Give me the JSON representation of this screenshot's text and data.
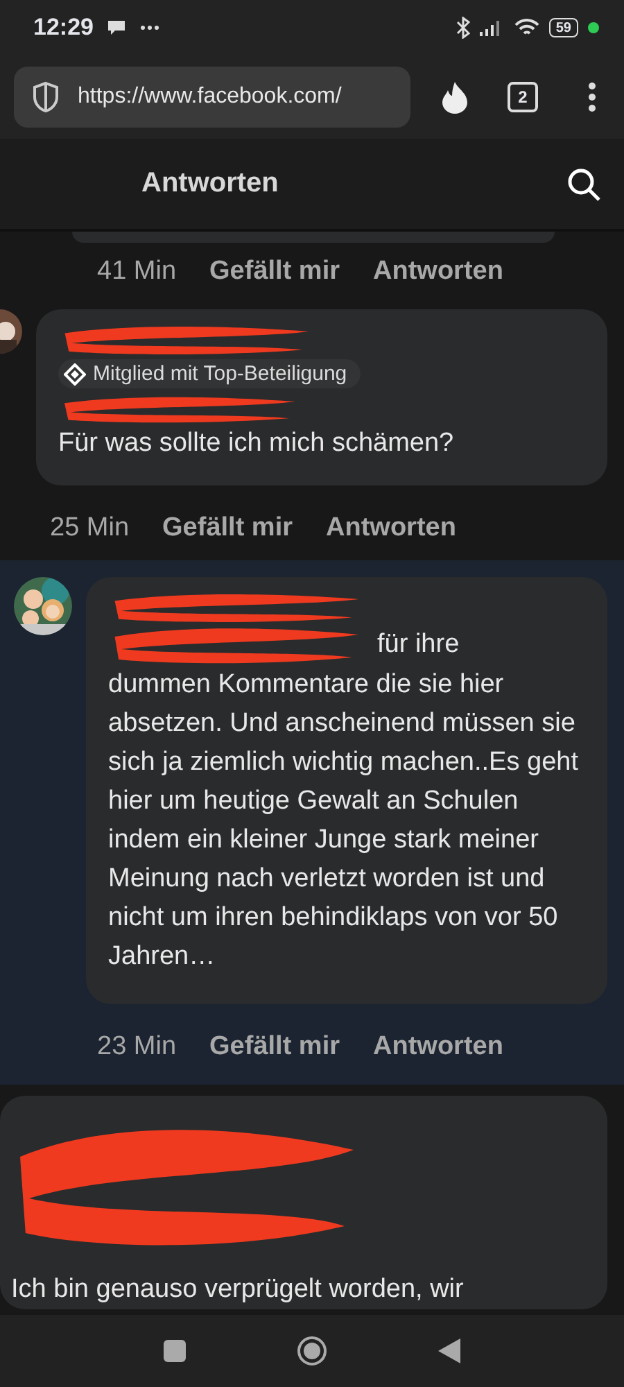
{
  "status_bar": {
    "time": "12:29",
    "battery": "59"
  },
  "browser": {
    "url": "https://www.facebook.com/",
    "tab_count": "2"
  },
  "header": {
    "title": "Antworten"
  },
  "comments": [
    {
      "kind": "tail",
      "meta": {
        "time": "41 Min",
        "like": "Gefällt mir",
        "reply": "Antworten"
      }
    },
    {
      "kind": "reply_edge",
      "highlighted": false,
      "badge": "Mitglied mit Top-Beteiligung",
      "text": "Für was sollte ich mich schämen?",
      "meta": {
        "time": "25 Min",
        "like": "Gefällt mir",
        "reply": "Antworten"
      }
    },
    {
      "kind": "reply",
      "highlighted": true,
      "mention_tail": "für ihre",
      "text": "dummen Kommentare die sie hier absetzen. Und anscheinend müssen sie sich ja ziemlich wichtig machen..Es geht hier um heutige Gewalt an Schulen indem ein kleiner Junge stark meiner Meinung nach verletzt worden ist und nicht um ihren behindiklaps von vor 50 Jahren…",
      "meta": {
        "time": "23 Min",
        "like": "Gefällt mir",
        "reply": "Antworten"
      }
    },
    {
      "kind": "cut",
      "highlighted": false,
      "text": "Ich bin genauso verprügelt worden, wir"
    }
  ]
}
